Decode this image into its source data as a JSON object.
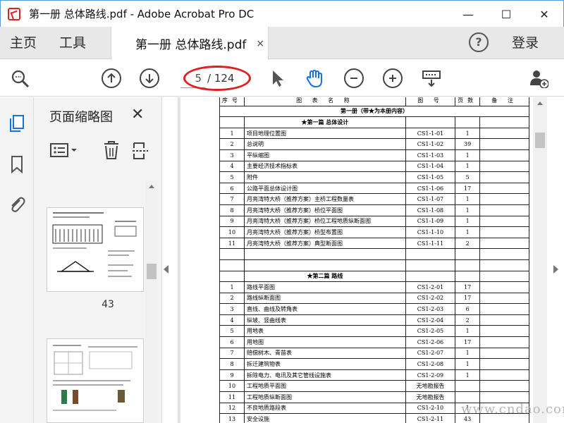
{
  "window": {
    "title": "第一册 总体路线.pdf - Adobe Acrobat Pro DC",
    "controls": [
      "—",
      "☐",
      "✕"
    ]
  },
  "tabs": {
    "home": "主页",
    "tools": "工具",
    "document": "第一册 总体路线.pdf",
    "close": "×",
    "help": "?",
    "login": "登录"
  },
  "toolbar": {
    "page_current": "5",
    "page_total": "/ 124",
    "icons": [
      "zoom-search-icon",
      "page-up-icon",
      "page-down-icon",
      "select-arrow-icon",
      "hand-tool-icon",
      "zoom-out-icon",
      "zoom-in-icon",
      "keyboard-icon",
      "share-user-icon"
    ]
  },
  "panel": {
    "title": "页面缩略图",
    "close": "✕",
    "thumb_label": "43"
  },
  "document": {
    "header": [
      "序号",
      "图 表 名 称",
      "图 号",
      "页数",
      "备 注"
    ],
    "volume_title": "第一册（带★为本册内容）",
    "sections": [
      {
        "title": "★第一篇  总体设计",
        "rows": [
          [
            "1",
            "项目地理位置图",
            "CS1-1-01",
            "1"
          ],
          [
            "2",
            "总说明",
            "CS1-1-02",
            "39"
          ],
          [
            "3",
            "平纵缩图",
            "CS1-1-03",
            "1"
          ],
          [
            "4",
            "主要经济技术指标表",
            "CS1-1-04",
            "1"
          ],
          [
            "5",
            "附件",
            "CS1-1-05",
            "5"
          ],
          [
            "6",
            "公路平面总体设计图",
            "CS1-1-06",
            "17"
          ],
          [
            "7",
            "月亮湾特大桥（推荐方案）主桥工程数量表",
            "CS1-1-07",
            "1"
          ],
          [
            "8",
            "月亮湾特大桥（推荐方案）桥位平面图",
            "CS1-1-08",
            "1"
          ],
          [
            "9",
            "月亮湾特大桥（推荐方案）桥位工程地质纵断面图",
            "CS1-1-09",
            "1"
          ],
          [
            "10",
            "月亮湾特大桥（推荐方案）桥型布置图",
            "CS1-1-10",
            "1"
          ],
          [
            "11",
            "月亮湾特大桥（推荐方案）典型断面图",
            "CS1-1-11",
            "2"
          ]
        ]
      },
      {
        "title": "★第二篇      路线",
        "rows": [
          [
            "1",
            "路线平面图",
            "CS1-2-01",
            "17"
          ],
          [
            "2",
            "路线纵断面图",
            "CS1-2-02",
            "17"
          ],
          [
            "3",
            "直线、曲线及转角表",
            "CS1-2-03",
            "6"
          ],
          [
            "4",
            "纵坡、竖曲线表",
            "CS1-2-04",
            "2"
          ],
          [
            "5",
            "用地表",
            "CS1-2-05",
            "1"
          ],
          [
            "6",
            "用地图",
            "CS1-2-06",
            "17"
          ],
          [
            "7",
            "赔偿树木、青苗表",
            "CS1-2-07",
            "1"
          ],
          [
            "8",
            "拆迁建筑物表",
            "CS1-2-08",
            "1"
          ],
          [
            "9",
            "拆除电力、电讯及其它管线设施表",
            "CS1-2-09",
            "1"
          ],
          [
            "10",
            "工程地质平面图",
            "无地勘报告",
            ""
          ],
          [
            "11",
            "工程地质纵断面图",
            "无地勘报告",
            ""
          ],
          [
            "12",
            "不良地质路段表",
            "CS1-2-10",
            "1"
          ],
          [
            "13",
            "安全设施",
            "CS1-2-11",
            "43"
          ]
        ]
      }
    ]
  },
  "watermark": "www.cndao.com",
  "colors": {
    "accent": "#1473e6",
    "annotation": "#e02020"
  }
}
